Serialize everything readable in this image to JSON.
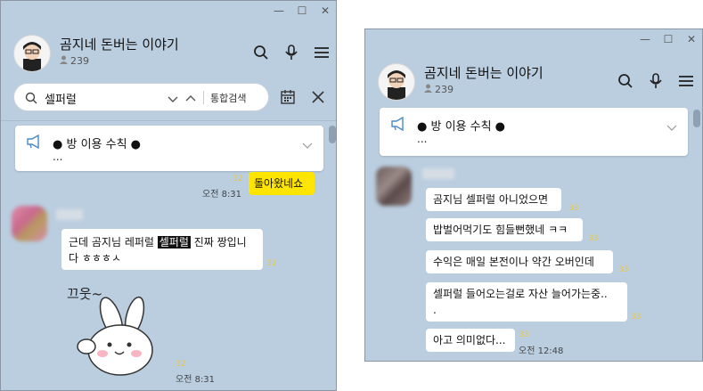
{
  "left": {
    "window_controls": {
      "minimize": "—",
      "maximize": "☐",
      "close": "✕"
    },
    "room": {
      "title": "곰지네 돈버는 이야기",
      "members": "239"
    },
    "search": {
      "query": "셀퍼럴",
      "combined_label": "통합검색"
    },
    "notice": {
      "title": "● 방 이용 수칙 ●",
      "desc": "..."
    },
    "messages": {
      "sent_reply": {
        "text": "돌아왔네쇼",
        "time": "오전 8:31",
        "unread": "32"
      },
      "received_1": {
        "pre": "근데 곰지님 레퍼럴 ",
        "highlight": "셀퍼럴",
        "post": " 진짜 짱입니다 ㅎㅎㅎㅅ",
        "unread": "32"
      },
      "sticker": {
        "text": "끄웃~",
        "time": "오전 8:31",
        "unread": "32"
      }
    }
  },
  "right": {
    "window_controls": {
      "minimize": "—",
      "maximize": "☐",
      "close": "✕"
    },
    "room": {
      "title": "곰지네 돈버는 이야기",
      "members": "239"
    },
    "notice": {
      "title": "● 방 이용 수칙 ●",
      "desc": "..."
    },
    "messages": [
      {
        "text": "곰지님 셀퍼럴 아니었으면",
        "unread": "33"
      },
      {
        "text": "밥벌어먹기도 힘들뻔했네 ㅋㅋ",
        "unread": "33"
      },
      {
        "text": "수익은 매일 본전이나 약간 오버인데",
        "unread": "33"
      },
      {
        "text": "셀퍼럴 들어오는걸로 자산 늘어가는중..",
        "text2": ".",
        "unread": "33"
      },
      {
        "text": "아고 의미없다...",
        "unread": "33",
        "time": "오전 12:48"
      }
    ]
  },
  "colors": {
    "chat_bg": "#bacee0",
    "my_bubble": "#fee500",
    "unread": "#e8c84a"
  }
}
